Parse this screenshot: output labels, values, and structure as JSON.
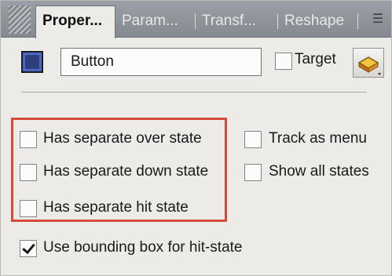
{
  "tabs": [
    {
      "label": "Proper...",
      "active": true
    },
    {
      "label": "Param...",
      "active": false
    },
    {
      "label": "Transf...",
      "active": false
    },
    {
      "label": "Reshape",
      "active": false
    }
  ],
  "name_field": {
    "value": "Button"
  },
  "target": {
    "label": "Target",
    "checked": false
  },
  "options_left": [
    {
      "label": "Has separate over state",
      "checked": false
    },
    {
      "label": "Has separate down state",
      "checked": false
    },
    {
      "label": "Has separate hit state",
      "checked": false
    }
  ],
  "options_right": [
    {
      "label": "Track as menu",
      "checked": false
    },
    {
      "label": "Show all states",
      "checked": false
    }
  ],
  "bounding_box": {
    "label": "Use bounding box for hit-state",
    "checked": true
  },
  "colors": {
    "highlight": "#d64a3a",
    "swatch": "#2d3f7d",
    "tab_bar": "#9ba0a6"
  },
  "icons": [
    "grip-icon",
    "panel-menu-icon",
    "color-swatch-icon",
    "button-symbol-icon"
  ]
}
